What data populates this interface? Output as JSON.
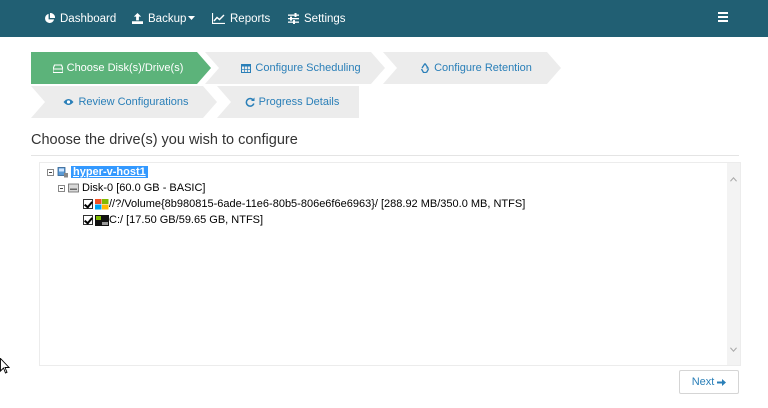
{
  "nav": {
    "dashboard": "Dashboard",
    "backup": "Backup",
    "reports": "Reports",
    "settings": "Settings"
  },
  "wizard": {
    "steps": [
      {
        "label": "Choose Disk(s)/Drive(s)",
        "icon": "hdd-icon",
        "active": true
      },
      {
        "label": "Configure Scheduling",
        "icon": "calendar-icon",
        "active": false
      },
      {
        "label": "Configure Retention",
        "icon": "recycle-icon",
        "active": false
      },
      {
        "label": "Review Configurations",
        "icon": "eye-icon",
        "active": false
      },
      {
        "label": "Progress Details",
        "icon": "refresh-icon",
        "active": false
      }
    ]
  },
  "main": {
    "heading": "Choose the drive(s) you wish to configure",
    "tree": {
      "host": "hyper-v-host1",
      "disk": "Disk-0 [60.0 GB - BASIC]",
      "volumes": [
        {
          "label": "//?/Volume{8b980815-6ade-11e6-80b5-806e6f6e6963}/ [288.92 MB/350.0 MB, NTFS]",
          "checked": true
        },
        {
          "label": "C:/ [17.50 GB/59.65 GB, NTFS]",
          "checked": true
        }
      ]
    }
  },
  "footer": {
    "next_label": "Next"
  },
  "colors": {
    "navbar": "#215f73",
    "active_step": "#5cb37a",
    "inactive_step": "#ececec",
    "link": "#2a7fb8",
    "selection": "#3399ff"
  }
}
